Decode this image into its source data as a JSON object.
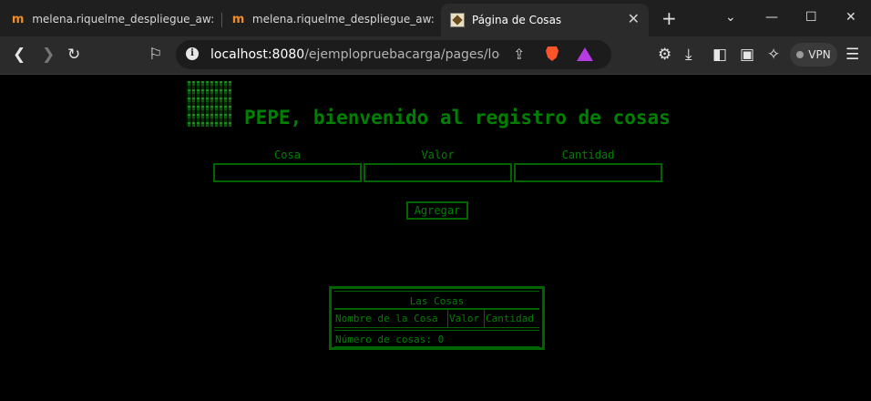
{
  "browser": {
    "tabs": [
      {
        "label": "melena.riquelme_despliegue_aw: Pr",
        "active": false
      },
      {
        "label": "melena.riquelme_despliegue_aw: Pr",
        "active": false
      },
      {
        "label": "Página de Cosas",
        "active": true
      }
    ],
    "url_host": "localhost:8080",
    "url_path": "/ejemplopruebacarga/pages/login.j...",
    "vpn_label": "VPN"
  },
  "page": {
    "heading": "PEPE, bienvenido al registro de cosas",
    "form": {
      "labels": [
        "Cosa",
        "Valor",
        "Cantidad"
      ],
      "values": [
        "",
        "",
        ""
      ],
      "submit_label": "Agregar"
    },
    "table": {
      "caption": "Las Cosas",
      "headers": [
        "Nombre de la Cosa",
        "Valor",
        "Cantidad"
      ],
      "footer": "Número de cosas: 0"
    }
  },
  "colors": {
    "page_background": "#000000",
    "text_green": "#008000",
    "border_green": "#006400",
    "browser_chrome": "#2b2b2b"
  }
}
